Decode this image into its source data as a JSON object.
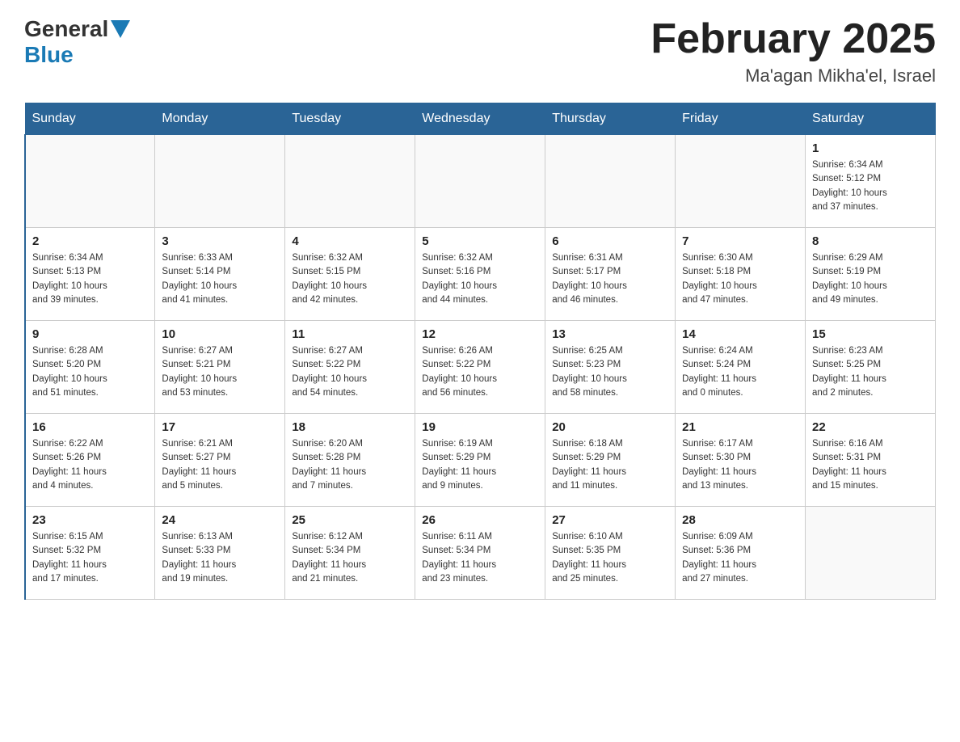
{
  "header": {
    "logo": {
      "part1": "General",
      "part2": "Blue"
    },
    "title": "February 2025",
    "location": "Ma'agan Mikha'el, Israel"
  },
  "calendar": {
    "days_of_week": [
      "Sunday",
      "Monday",
      "Tuesday",
      "Wednesday",
      "Thursday",
      "Friday",
      "Saturday"
    ],
    "weeks": [
      [
        {
          "day": "",
          "info": ""
        },
        {
          "day": "",
          "info": ""
        },
        {
          "day": "",
          "info": ""
        },
        {
          "day": "",
          "info": ""
        },
        {
          "day": "",
          "info": ""
        },
        {
          "day": "",
          "info": ""
        },
        {
          "day": "1",
          "info": "Sunrise: 6:34 AM\nSunset: 5:12 PM\nDaylight: 10 hours\nand 37 minutes."
        }
      ],
      [
        {
          "day": "2",
          "info": "Sunrise: 6:34 AM\nSunset: 5:13 PM\nDaylight: 10 hours\nand 39 minutes."
        },
        {
          "day": "3",
          "info": "Sunrise: 6:33 AM\nSunset: 5:14 PM\nDaylight: 10 hours\nand 41 minutes."
        },
        {
          "day": "4",
          "info": "Sunrise: 6:32 AM\nSunset: 5:15 PM\nDaylight: 10 hours\nand 42 minutes."
        },
        {
          "day": "5",
          "info": "Sunrise: 6:32 AM\nSunset: 5:16 PM\nDaylight: 10 hours\nand 44 minutes."
        },
        {
          "day": "6",
          "info": "Sunrise: 6:31 AM\nSunset: 5:17 PM\nDaylight: 10 hours\nand 46 minutes."
        },
        {
          "day": "7",
          "info": "Sunrise: 6:30 AM\nSunset: 5:18 PM\nDaylight: 10 hours\nand 47 minutes."
        },
        {
          "day": "8",
          "info": "Sunrise: 6:29 AM\nSunset: 5:19 PM\nDaylight: 10 hours\nand 49 minutes."
        }
      ],
      [
        {
          "day": "9",
          "info": "Sunrise: 6:28 AM\nSunset: 5:20 PM\nDaylight: 10 hours\nand 51 minutes."
        },
        {
          "day": "10",
          "info": "Sunrise: 6:27 AM\nSunset: 5:21 PM\nDaylight: 10 hours\nand 53 minutes."
        },
        {
          "day": "11",
          "info": "Sunrise: 6:27 AM\nSunset: 5:22 PM\nDaylight: 10 hours\nand 54 minutes."
        },
        {
          "day": "12",
          "info": "Sunrise: 6:26 AM\nSunset: 5:22 PM\nDaylight: 10 hours\nand 56 minutes."
        },
        {
          "day": "13",
          "info": "Sunrise: 6:25 AM\nSunset: 5:23 PM\nDaylight: 10 hours\nand 58 minutes."
        },
        {
          "day": "14",
          "info": "Sunrise: 6:24 AM\nSunset: 5:24 PM\nDaylight: 11 hours\nand 0 minutes."
        },
        {
          "day": "15",
          "info": "Sunrise: 6:23 AM\nSunset: 5:25 PM\nDaylight: 11 hours\nand 2 minutes."
        }
      ],
      [
        {
          "day": "16",
          "info": "Sunrise: 6:22 AM\nSunset: 5:26 PM\nDaylight: 11 hours\nand 4 minutes."
        },
        {
          "day": "17",
          "info": "Sunrise: 6:21 AM\nSunset: 5:27 PM\nDaylight: 11 hours\nand 5 minutes."
        },
        {
          "day": "18",
          "info": "Sunrise: 6:20 AM\nSunset: 5:28 PM\nDaylight: 11 hours\nand 7 minutes."
        },
        {
          "day": "19",
          "info": "Sunrise: 6:19 AM\nSunset: 5:29 PM\nDaylight: 11 hours\nand 9 minutes."
        },
        {
          "day": "20",
          "info": "Sunrise: 6:18 AM\nSunset: 5:29 PM\nDaylight: 11 hours\nand 11 minutes."
        },
        {
          "day": "21",
          "info": "Sunrise: 6:17 AM\nSunset: 5:30 PM\nDaylight: 11 hours\nand 13 minutes."
        },
        {
          "day": "22",
          "info": "Sunrise: 6:16 AM\nSunset: 5:31 PM\nDaylight: 11 hours\nand 15 minutes."
        }
      ],
      [
        {
          "day": "23",
          "info": "Sunrise: 6:15 AM\nSunset: 5:32 PM\nDaylight: 11 hours\nand 17 minutes."
        },
        {
          "day": "24",
          "info": "Sunrise: 6:13 AM\nSunset: 5:33 PM\nDaylight: 11 hours\nand 19 minutes."
        },
        {
          "day": "25",
          "info": "Sunrise: 6:12 AM\nSunset: 5:34 PM\nDaylight: 11 hours\nand 21 minutes."
        },
        {
          "day": "26",
          "info": "Sunrise: 6:11 AM\nSunset: 5:34 PM\nDaylight: 11 hours\nand 23 minutes."
        },
        {
          "day": "27",
          "info": "Sunrise: 6:10 AM\nSunset: 5:35 PM\nDaylight: 11 hours\nand 25 minutes."
        },
        {
          "day": "28",
          "info": "Sunrise: 6:09 AM\nSunset: 5:36 PM\nDaylight: 11 hours\nand 27 minutes."
        },
        {
          "day": "",
          "info": ""
        }
      ]
    ]
  }
}
